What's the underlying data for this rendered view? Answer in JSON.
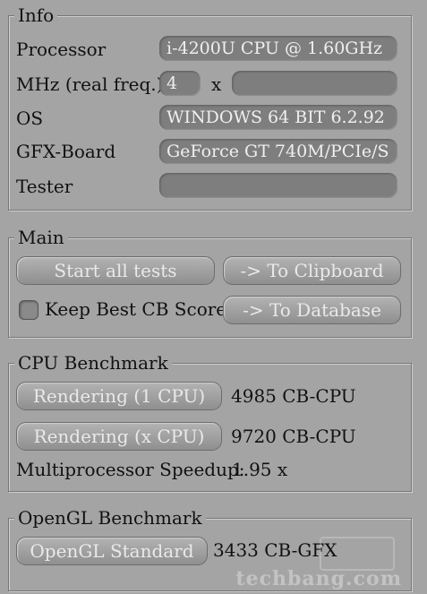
{
  "info": {
    "title": "Info",
    "processor_label": "Processor",
    "processor_value": "i-4200U CPU @ 1.60GHz",
    "mhz_label": "MHz (real freq.)",
    "mhz_value": "4",
    "mhz_times": "x",
    "mhz_freq_value": "",
    "os_label": "OS",
    "os_value": "WINDOWS 64 BIT 6.2.92",
    "gfx_label": "GFX-Board",
    "gfx_value": "GeForce GT 740M/PCIe/S",
    "tester_label": "Tester",
    "tester_value": ""
  },
  "main": {
    "title": "Main",
    "start_all": "Start all tests",
    "to_clipboard": "-> To Clipboard",
    "keep_best": "Keep Best CB Score",
    "keep_best_checked": false,
    "to_database": "-> To Database"
  },
  "cpu": {
    "title": "CPU Benchmark",
    "single_button": "Rendering (1 CPU)",
    "single_result": "4985 CB-CPU",
    "multi_button": "Rendering (x CPU)",
    "multi_result": "9720 CB-CPU",
    "speedup_label": "Multiprocessor Speedup:",
    "speedup_value": "1.95 x"
  },
  "opengl": {
    "title": "OpenGL Benchmark",
    "button": "OpenGL Standard",
    "result": "3433 CB-GFX"
  },
  "watermark": "techbang.com"
}
